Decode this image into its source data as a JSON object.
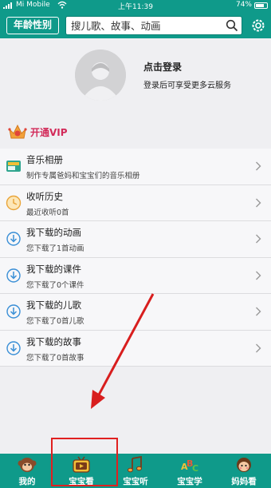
{
  "status_bar": {
    "carrier": "Mi Mobile",
    "time": "上午11:39",
    "battery": "74%"
  },
  "header": {
    "age_gender_label": "年龄性别",
    "search_placeholder": "搜儿歌、故事、动画"
  },
  "profile": {
    "login_title": "点击登录",
    "login_subtitle": "登录后可享受更多云服务"
  },
  "vip": {
    "label": "开通VIP"
  },
  "menu": [
    {
      "title": "音乐相册",
      "subtitle": "制作专属爸妈和宝宝们的音乐相册",
      "icon": "album-icon"
    },
    {
      "title": "收听历史",
      "subtitle": "最近收听0首",
      "icon": "clock-icon"
    },
    {
      "title": "我下载的动画",
      "subtitle": "您下载了1首动画",
      "icon": "download-icon"
    },
    {
      "title": "我下载的课件",
      "subtitle": "您下载了0个课件",
      "icon": "download-icon"
    },
    {
      "title": "我下载的儿歌",
      "subtitle": "您下载了0首儿歌",
      "icon": "download-icon"
    },
    {
      "title": "我下载的故事",
      "subtitle": "您下载了0首故事",
      "icon": "download-icon"
    }
  ],
  "tabs": [
    {
      "label": "我的",
      "icon": "monkey-icon"
    },
    {
      "label": "宝宝看",
      "icon": "tv-icon"
    },
    {
      "label": "宝宝听",
      "icon": "music-icon"
    },
    {
      "label": "宝宝学",
      "icon": "abc-icon"
    },
    {
      "label": "妈妈看",
      "icon": "mom-icon"
    }
  ],
  "colors": {
    "brand_teal": "#0f9a8a",
    "vip_pink": "#d22a59",
    "annotation_red": "#e02020"
  }
}
